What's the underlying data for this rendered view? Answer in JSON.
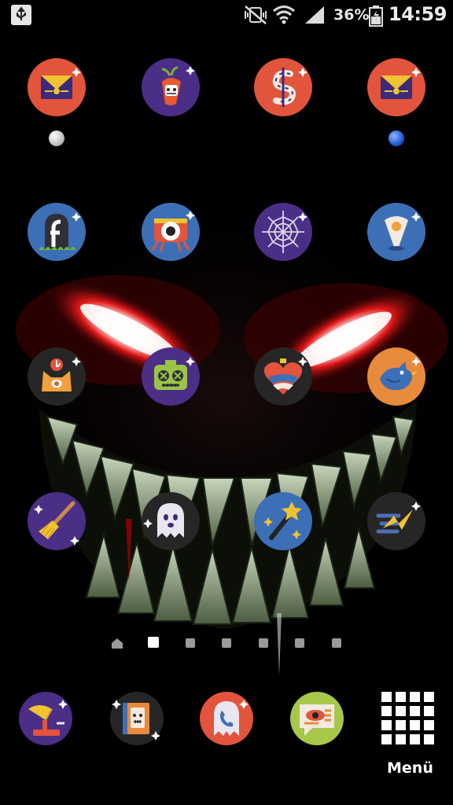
{
  "status_bar": {
    "usb_icon": "usb-icon",
    "mute_icon": "vibrate-muted-icon",
    "wifi_icon": "wifi-icon",
    "signal_icon": "cell-signal-icon",
    "battery_percent": "36%",
    "battery_icon": "battery-charging-icon",
    "time": "14:59"
  },
  "home_grid": {
    "rows": [
      [
        {
          "name": "mail-envelope-app",
          "icon": "envelope-icon",
          "bg": "#e2543c"
        },
        {
          "name": "carrot-app",
          "icon": "carrot-face-icon",
          "bg": "#4b2e86"
        },
        {
          "name": "dollar-bone-app",
          "icon": "dollar-bone-icon",
          "bg": "#e2543c"
        },
        {
          "name": "mail-envelope-app-2",
          "icon": "envelope-icon",
          "bg": "#e2543c"
        }
      ],
      [
        {
          "name": "facebook-tombstone-app",
          "icon": "tombstone-f-icon",
          "bg": "#3d6fb6"
        },
        {
          "name": "camera-creature-app",
          "icon": "camera-creature-icon",
          "bg": "#3d6fb6"
        },
        {
          "name": "spiderweb-app",
          "icon": "spiderweb-icon",
          "bg": "#4b2e86"
        },
        {
          "name": "maps-pin-app",
          "icon": "map-pin-icon",
          "bg": "#3d6fb6"
        }
      ],
      [
        {
          "name": "cat-eye-app",
          "icon": "cat-eye-icon",
          "bg": "#262626"
        },
        {
          "name": "zombie-radio-app",
          "icon": "zombie-robot-icon",
          "bg": "#4b2e86"
        },
        {
          "name": "heart-potion-app",
          "icon": "heart-icon",
          "bg": "#262626"
        },
        {
          "name": "blue-bird-app",
          "icon": "bird-icon",
          "bg": "#e88a3c"
        }
      ],
      [
        {
          "name": "broom-app",
          "icon": "broom-icon",
          "bg": "#4b2e86"
        },
        {
          "name": "ghost-app",
          "icon": "ghost-icon",
          "bg": "#262626"
        },
        {
          "name": "magic-wand-app",
          "icon": "magic-wand-icon",
          "bg": "#3d6fb6"
        },
        {
          "name": "lightning-messenger-app",
          "icon": "lightning-icon",
          "bg": "#262626"
        }
      ]
    ]
  },
  "widget_dots": {
    "left_color": "#e8e8e8",
    "right_color": "#2457d6"
  },
  "page_indicators": {
    "count": 7,
    "active_index": 1,
    "home_index": 0
  },
  "dock": {
    "items": [
      {
        "name": "gramophone-app",
        "icon": "gramophone-icon",
        "bg": "#4b2e86"
      },
      {
        "name": "contacts-book-app",
        "icon": "book-face-icon",
        "bg": "#262626"
      },
      {
        "name": "phone-ghost-app",
        "icon": "phone-icon",
        "bg": "#e2543c"
      },
      {
        "name": "messages-eye-app",
        "icon": "speech-eye-icon",
        "bg": "#a7c84a"
      }
    ],
    "menu_label": "Menü",
    "menu_icon": "app-grid-icon"
  }
}
